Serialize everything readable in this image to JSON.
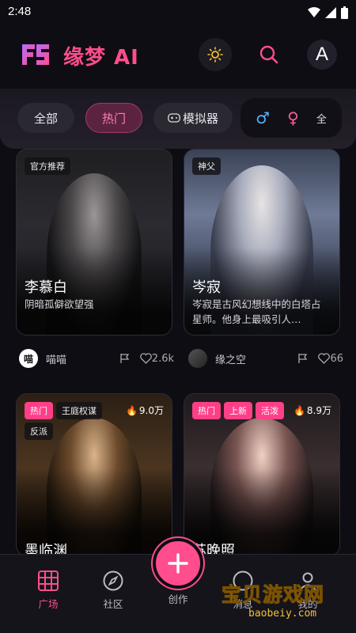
{
  "status": {
    "time": "2:48"
  },
  "header": {
    "title": "缘梦 AI",
    "avatar_letter": "A"
  },
  "tabs": [
    {
      "label": "全部",
      "active": false
    },
    {
      "label": "热门",
      "active": true
    },
    {
      "label": "模拟器",
      "active": false
    }
  ],
  "gender_filter": {
    "male": "♂",
    "female": "♀",
    "all": "全"
  },
  "cards": [
    {
      "tags": [
        "官方推荐"
      ],
      "name": "李慕白",
      "desc": "阴暗孤僻欲望强",
      "author": "喵喵",
      "author_initial": "喵",
      "likes": "2.6k"
    },
    {
      "tags": [
        "神父"
      ],
      "name": "岑寂",
      "desc": "岑寂是古风幻想线中的白塔占星师。他身上最吸引人…",
      "author": "缘之空",
      "likes": "66"
    },
    {
      "tags": [
        "热门",
        "王庭权谋",
        "反派"
      ],
      "hot": "9.0万",
      "name": "墨临渊"
    },
    {
      "tags": [
        "热门",
        "上新",
        "活泼"
      ],
      "hot": "8.9万",
      "name": "苏晚照"
    }
  ],
  "nav": [
    {
      "label": "广场",
      "active": true
    },
    {
      "label": "社区",
      "active": false
    },
    {
      "label": "创作",
      "active": false
    },
    {
      "label": "消息",
      "active": false
    },
    {
      "label": "我的",
      "active": false
    }
  ],
  "watermark": {
    "text": "宝贝游戏网",
    "url": "baobeiy.com"
  },
  "colors": {
    "accent": "#ff4d8d",
    "bg": "#0e0d13"
  }
}
